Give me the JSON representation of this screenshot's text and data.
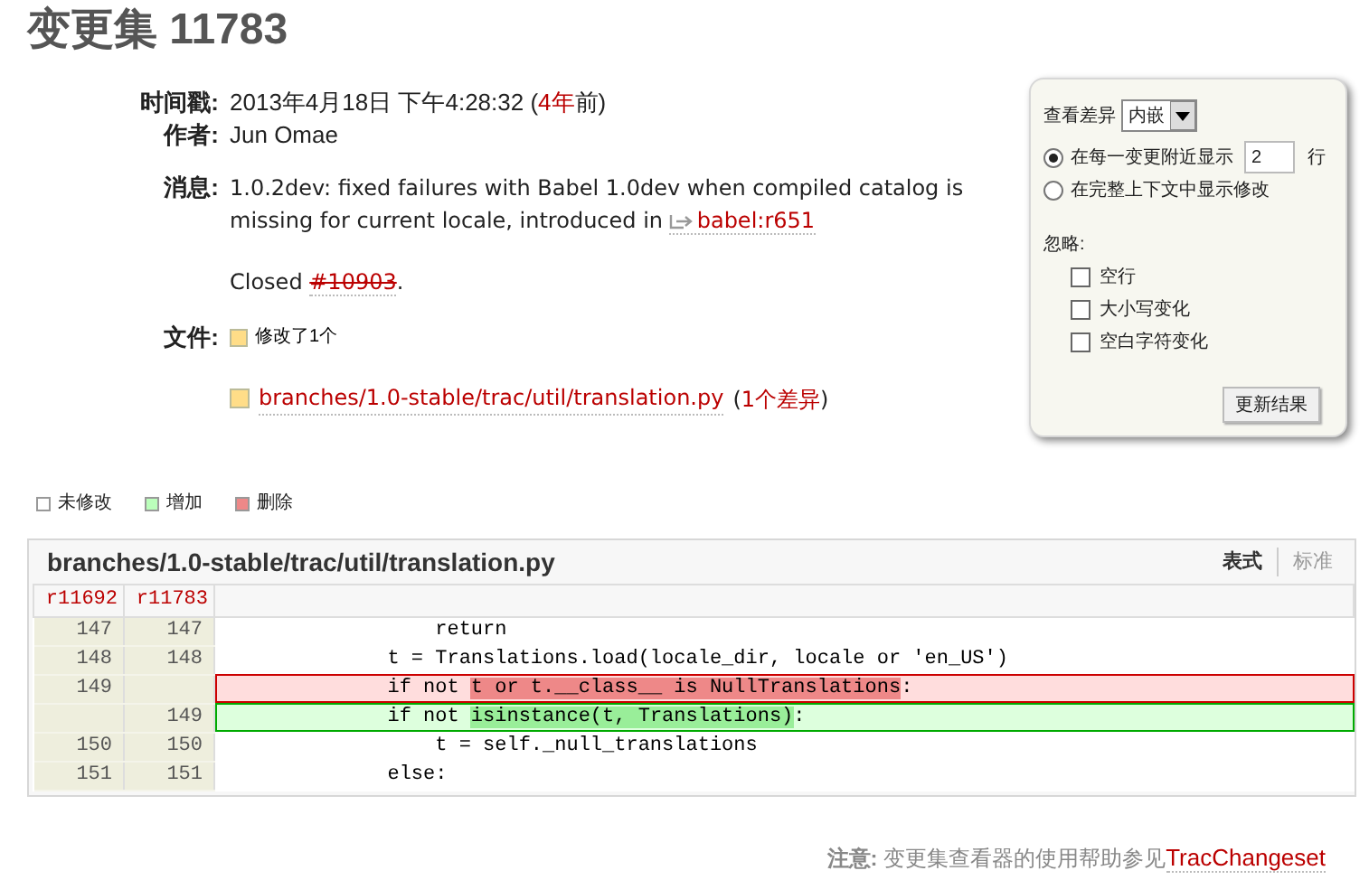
{
  "title": "变更集 11783",
  "meta": {
    "timestamp_label": "时间戳:",
    "timestamp": "2013年4月18日 下午4:28:32 (",
    "age": "4年",
    "age_suffix": "前)",
    "author_label": "作者:",
    "author": "Jun Omae",
    "message_label": "消息:",
    "message": "1.0.2dev: fixed failures with Babel 1.0dev when compiled catalog is missing for current locale, introduced in",
    "message_link": "babel:r651",
    "closed_prefix": "Closed",
    "closed_ticket": "#10903",
    "closed_suffix": ".",
    "files_label": "文件:",
    "files_summary": "修改了1个",
    "file_path": "branches/1.0-stable/trac/util/translation.py",
    "diff_count_open": "(",
    "diff_count": "1个差异",
    "diff_count_close": ")"
  },
  "options": {
    "view_label": "查看差异",
    "view_value": "内嵌",
    "radios": [
      {
        "label": "在每一变更附近显示",
        "selected": true,
        "value": "2",
        "unit": "行"
      },
      {
        "label": "在完整上下文中显示修改",
        "selected": false
      }
    ],
    "ignore_label": "忽略:",
    "ignore": [
      {
        "label": "空行",
        "checked": false
      },
      {
        "label": "大小写变化",
        "checked": false
      },
      {
        "label": "空白字符变化",
        "checked": false
      }
    ],
    "button": "更新结果"
  },
  "legend": [
    {
      "label": "未修改",
      "color": "#ffffff"
    },
    {
      "label": "增加",
      "color": "#bbffbb"
    },
    {
      "label": "删除",
      "color": "#ee8888"
    }
  ],
  "diff": {
    "path": "branches/1.0-stable/trac/util/translation.py",
    "views": [
      {
        "label": "表式",
        "selected": true
      },
      {
        "label": "标准",
        "selected": false
      }
    ],
    "old_rev": "r11692",
    "new_rev": "r11783",
    "lines": [
      {
        "kind": "context",
        "old": "147",
        "new": "147",
        "parts": [
          {
            "text": "                return"
          }
        ]
      },
      {
        "kind": "context",
        "old": "148",
        "new": "148",
        "parts": [
          {
            "text": "            t = Translations.load(locale_dir, locale or 'en_US')"
          }
        ]
      },
      {
        "kind": "removed",
        "old": "149",
        "parts": [
          {
            "text": "            if not ",
            "changed": false
          },
          {
            "text": "t or t.__class__ is NullTranslations",
            "changed": true
          },
          {
            "text": ":",
            "changed": false
          }
        ]
      },
      {
        "kind": "added",
        "new": "149",
        "parts": [
          {
            "text": "            if not ",
            "changed": false
          },
          {
            "text": "isinstance(t, Translations)",
            "changed": true
          },
          {
            "text": ":",
            "changed": false
          }
        ]
      },
      {
        "kind": "context",
        "old": "150",
        "new": "150",
        "parts": [
          {
            "text": "                t = self._null_translations"
          }
        ]
      },
      {
        "kind": "context",
        "old": "151",
        "new": "151",
        "parts": [
          {
            "text": "            else:"
          }
        ]
      }
    ]
  },
  "note": {
    "label": "注意:",
    "text": "变更集查看器的使用帮助参见",
    "link": "TracChangeset"
  }
}
